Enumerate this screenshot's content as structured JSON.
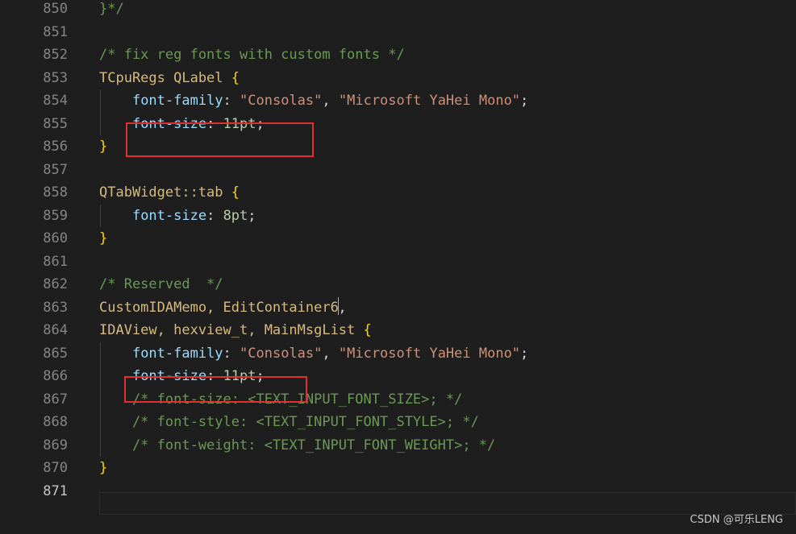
{
  "editor": {
    "line_numbers": [
      "850",
      "851",
      "852",
      "853",
      "854",
      "855",
      "856",
      "857",
      "858",
      "859",
      "860",
      "861",
      "862",
      "863",
      "864",
      "865",
      "866",
      "867",
      "868",
      "869",
      "870",
      "871"
    ],
    "lines": [
      [
        {
          "t": "}*/",
          "c": "cmt"
        }
      ],
      [],
      [
        {
          "t": "/* fix reg fonts with custom fonts */",
          "c": "cmt"
        }
      ],
      [
        {
          "t": "TCpuRegs QLabel ",
          "c": "sel"
        },
        {
          "t": "{",
          "c": "brace"
        }
      ],
      [
        {
          "t": "    ",
          "c": "punc"
        },
        {
          "t": "font-family",
          "c": "prop"
        },
        {
          "t": ": ",
          "c": "punc"
        },
        {
          "t": "\"Consolas\"",
          "c": "str"
        },
        {
          "t": ", ",
          "c": "punc"
        },
        {
          "t": "\"Microsoft YaHei Mono\"",
          "c": "str"
        },
        {
          "t": ";",
          "c": "punc"
        }
      ],
      [
        {
          "t": "    ",
          "c": "punc"
        },
        {
          "t": "font-size",
          "c": "prop"
        },
        {
          "t": ": ",
          "c": "punc"
        },
        {
          "t": "11pt",
          "c": "num"
        },
        {
          "t": ";",
          "c": "punc"
        }
      ],
      [
        {
          "t": "}",
          "c": "brace"
        }
      ],
      [],
      [
        {
          "t": "QTabWidget::tab ",
          "c": "sel"
        },
        {
          "t": "{",
          "c": "brace"
        }
      ],
      [
        {
          "t": "    ",
          "c": "punc"
        },
        {
          "t": "font-size",
          "c": "prop"
        },
        {
          "t": ": ",
          "c": "punc"
        },
        {
          "t": "8pt",
          "c": "num"
        },
        {
          "t": ";",
          "c": "punc"
        }
      ],
      [
        {
          "t": "}",
          "c": "brace"
        }
      ],
      [],
      [
        {
          "t": "/* Reserved  */",
          "c": "cmt"
        }
      ],
      [
        {
          "t": "CustomIDAMemo, EditContainer6",
          "c": "sel"
        },
        {
          "t": ",",
          "c": "punc"
        }
      ],
      [
        {
          "t": "IDAView, hexview_t, MainMsgList ",
          "c": "sel"
        },
        {
          "t": "{",
          "c": "brace"
        }
      ],
      [
        {
          "t": "    ",
          "c": "punc"
        },
        {
          "t": "font-family",
          "c": "prop"
        },
        {
          "t": ": ",
          "c": "punc"
        },
        {
          "t": "\"Consolas\"",
          "c": "str"
        },
        {
          "t": ", ",
          "c": "punc"
        },
        {
          "t": "\"Microsoft YaHei Mono\"",
          "c": "str"
        },
        {
          "t": ";",
          "c": "punc"
        }
      ],
      [
        {
          "t": "    ",
          "c": "punc"
        },
        {
          "t": "font-size",
          "c": "prop"
        },
        {
          "t": ": ",
          "c": "punc"
        },
        {
          "t": "11pt",
          "c": "num"
        },
        {
          "t": ";",
          "c": "punc"
        }
      ],
      [
        {
          "t": "    /* font-size: <TEXT_INPUT_FONT_SIZE>; */",
          "c": "cmt"
        }
      ],
      [
        {
          "t": "    /* font-style: <TEXT_INPUT_FONT_STYLE>; */",
          "c": "cmt"
        }
      ],
      [
        {
          "t": "    /* font-weight: <TEXT_INPUT_FONT_WEIGHT>; */",
          "c": "cmt"
        }
      ],
      [
        {
          "t": "}",
          "c": "brace"
        }
      ],
      []
    ],
    "active_line": "871"
  },
  "colors": {
    "background": "#1e1e1e",
    "comment": "#6a9955",
    "selector": "#d7ba7d",
    "property": "#9cdcfe",
    "string": "#ce9178",
    "number": "#b5cea8",
    "brace": "#ffd700",
    "annotation_box": "#e03030"
  },
  "watermark": "CSDN @可乐LENG"
}
